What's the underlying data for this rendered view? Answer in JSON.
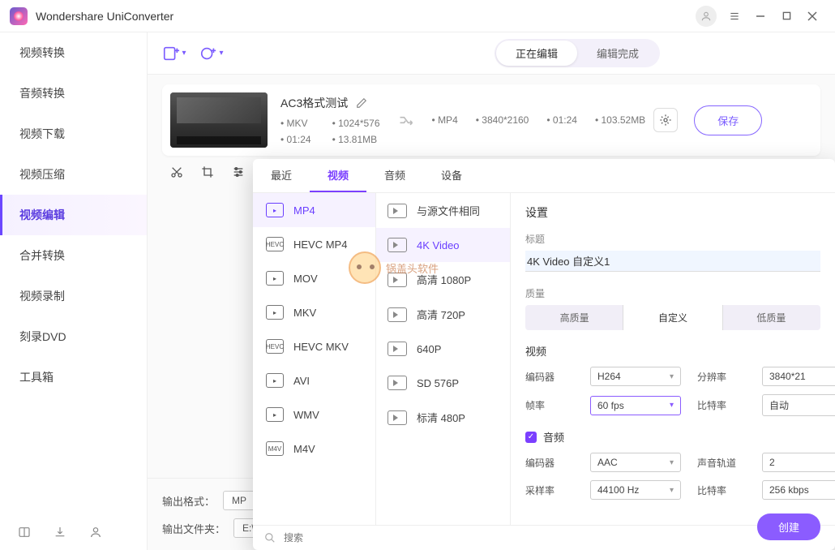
{
  "titlebar": {
    "title": "Wondershare UniConverter"
  },
  "sidebar": {
    "items": [
      {
        "label": "视频转换"
      },
      {
        "label": "音频转换"
      },
      {
        "label": "视频下载"
      },
      {
        "label": "视频压缩"
      },
      {
        "label": "视频编辑"
      },
      {
        "label": "合并转换"
      },
      {
        "label": "视频录制"
      },
      {
        "label": "刻录DVD"
      },
      {
        "label": "工具箱"
      }
    ],
    "active_index": 4
  },
  "topbar": {
    "tab_active": "正在编辑",
    "tab_done": "编辑完成"
  },
  "job": {
    "title": "AC3格式测试",
    "src_format": "MKV",
    "src_res": "1024*576",
    "src_dur": "01:24",
    "src_size": "13.81MB",
    "out_format": "MP4",
    "out_res": "3840*2160",
    "out_dur": "01:24",
    "out_size": "103.52MB",
    "save_label": "保存"
  },
  "bottombar": {
    "fmt_label": "输出格式：",
    "fmt_value": "MP",
    "folder_label": "输出文件夹：",
    "folder_value": "E:\\Wondershare UniConverter\\Edited"
  },
  "popup": {
    "tabs": [
      "最近",
      "视频",
      "音频",
      "设备"
    ],
    "active_tab_index": 1,
    "formats": [
      "MP4",
      "HEVC MP4",
      "MOV",
      "MKV",
      "HEVC MKV",
      "AVI",
      "WMV",
      "M4V"
    ],
    "format_icons": [
      "",
      "HEVC",
      "",
      "",
      "HEVC",
      "",
      "",
      "M4V"
    ],
    "active_format_index": 0,
    "presets": [
      "与源文件相同",
      "4K Video",
      "高清 1080P",
      "高清 720P",
      "640P",
      "SD 576P",
      "标清 480P"
    ],
    "active_preset_index": 1,
    "settings": {
      "header": "设置",
      "title_label": "标题",
      "title_value": "4K Video 自定义1",
      "quality_label": "质量",
      "quality_opts": [
        "高质量",
        "自定义",
        "低质量"
      ],
      "quality_active": 1,
      "video_label": "视频",
      "video_encoder_label": "编码器",
      "video_encoder": "H264",
      "video_res_label": "分辨率",
      "video_res": "3840*21",
      "video_fps_label": "帧率",
      "video_fps": "60 fps",
      "video_bitrate_label": "比特率",
      "video_bitrate": "自动",
      "audio_label": "音频",
      "audio_encoder_label": "编码器",
      "audio_encoder": "AAC",
      "audio_channel_label": "声音轨道",
      "audio_channel": "2",
      "audio_sample_label": "采样率",
      "audio_sample": "44100 Hz",
      "audio_bitrate_label": "比特率",
      "audio_bitrate": "256 kbps",
      "create_label": "创建"
    },
    "search_placeholder": "搜索"
  },
  "watermark": "锅盖头软件"
}
